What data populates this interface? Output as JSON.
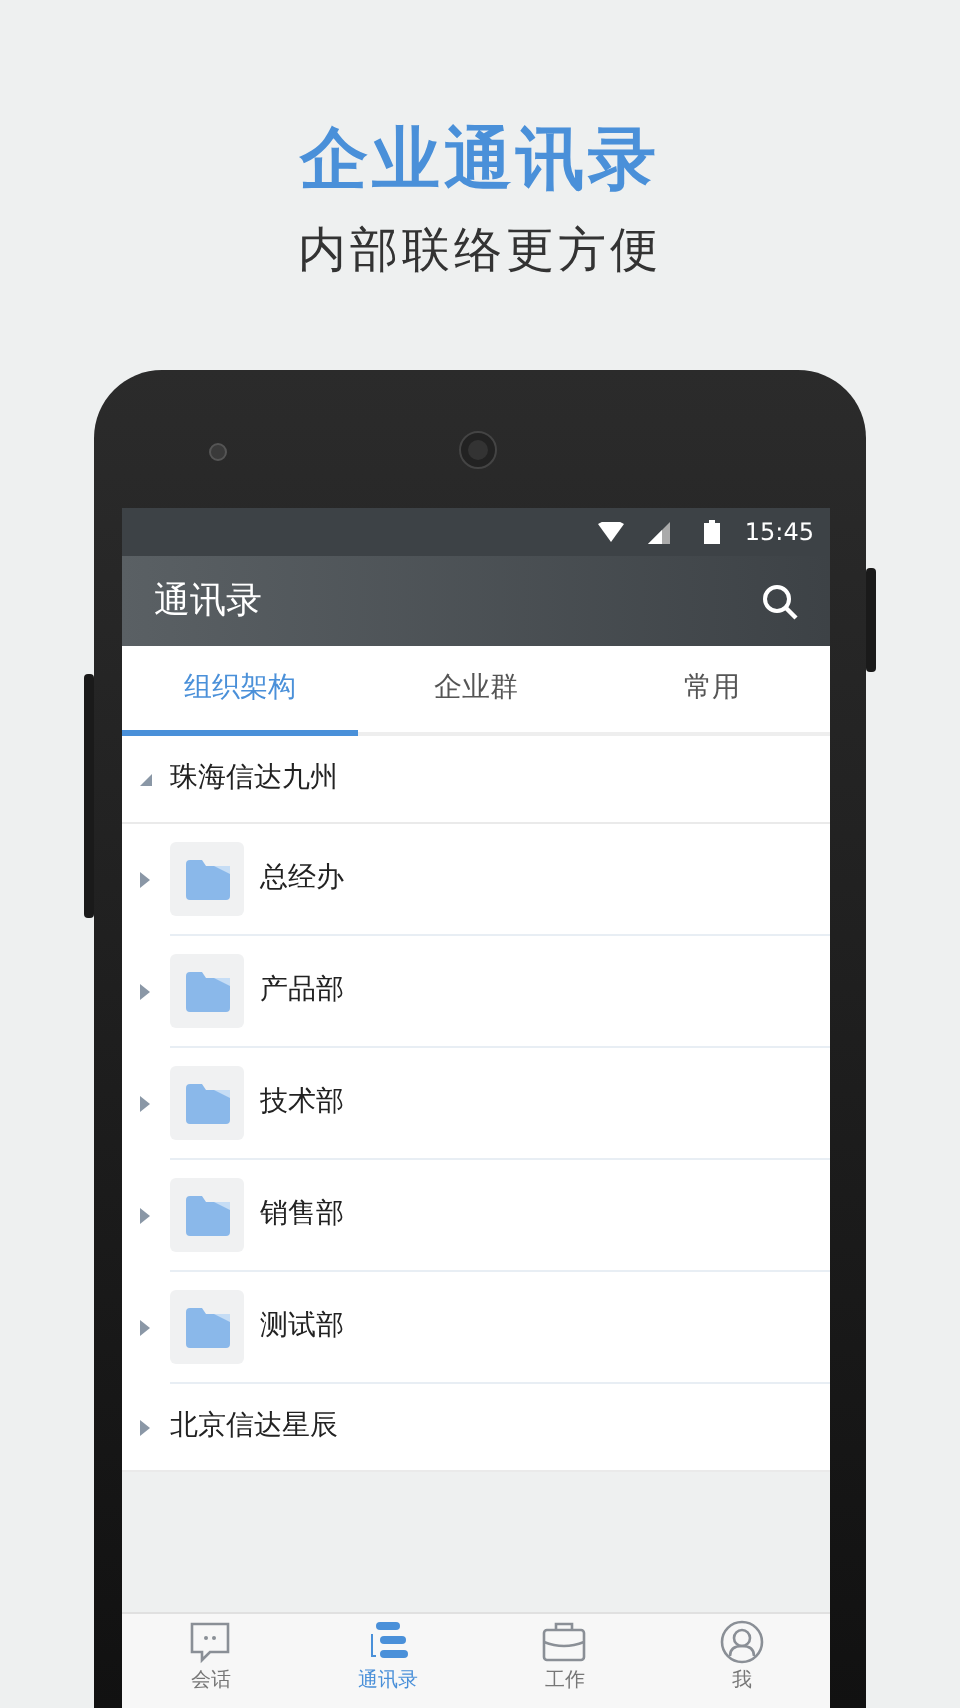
{
  "headline": "企业通讯录",
  "subheadline": "内部联络更方便",
  "status_bar": {
    "time": "15:45"
  },
  "toolbar": {
    "title": "通讯录"
  },
  "tabs": [
    {
      "label": "组织架构",
      "selected": true
    },
    {
      "label": "企业群",
      "selected": false
    },
    {
      "label": "常用",
      "selected": false
    }
  ],
  "tree": [
    {
      "label": "珠海信达九州",
      "expanded": true,
      "children": [
        {
          "label": "总经办",
          "expanded": false
        },
        {
          "label": "产品部",
          "expanded": false
        },
        {
          "label": "技术部",
          "expanded": false
        },
        {
          "label": "销售部",
          "expanded": false
        },
        {
          "label": "测试部",
          "expanded": false
        }
      ]
    },
    {
      "label": "北京信达星辰",
      "expanded": false
    }
  ],
  "bottom_nav": [
    {
      "kind": "chat",
      "label": "会话",
      "selected": false
    },
    {
      "kind": "contacts",
      "label": "通讯录",
      "selected": true
    },
    {
      "kind": "work",
      "label": "工作",
      "selected": false
    },
    {
      "kind": "profile",
      "label": "我",
      "selected": false
    }
  ]
}
